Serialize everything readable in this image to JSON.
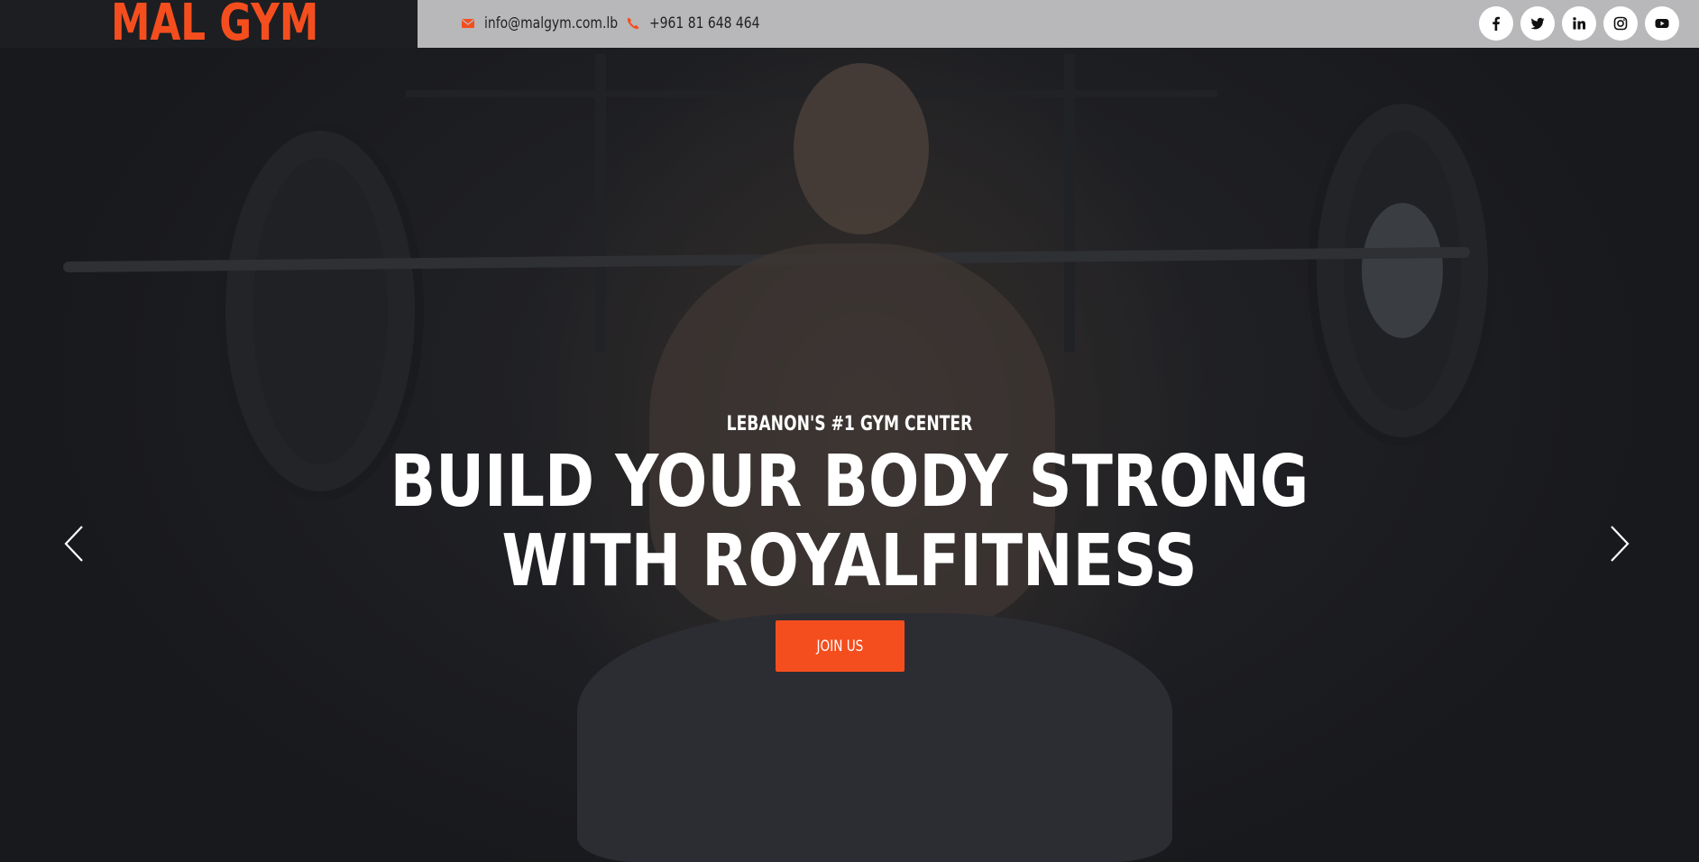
{
  "brand": {
    "name": "MAL GYM",
    "accent_color": "#f54e1e"
  },
  "contact": {
    "email": "info@malgym.com.lb",
    "phone": "+961 81 648 464",
    "email_icon": "envelope-icon",
    "phone_icon": "phone-icon"
  },
  "socials": [
    {
      "name": "facebook",
      "icon": "facebook-icon"
    },
    {
      "name": "twitter",
      "icon": "twitter-icon"
    },
    {
      "name": "linkedin",
      "icon": "linkedin-icon"
    },
    {
      "name": "instagram",
      "icon": "instagram-icon"
    },
    {
      "name": "youtube",
      "icon": "youtube-icon"
    }
  ],
  "hero": {
    "eyebrow": "LEBANON'S #1 GYM CENTER",
    "headline_line1": "BUILD YOUR BODY STRONG",
    "headline_line2": "WITH ROYALFITNESS",
    "cta_label": "JOIN US",
    "prev_icon": "chevron-left-icon",
    "next_icon": "chevron-right-icon"
  }
}
